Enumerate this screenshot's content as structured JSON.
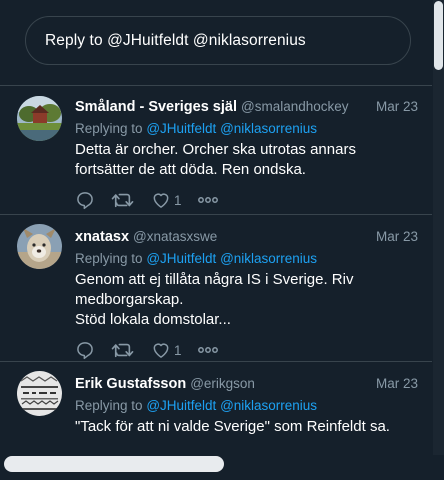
{
  "reply_box": {
    "text": "Reply to @JHuitfeldt @niklasorrenius"
  },
  "replying_label": "Replying to",
  "tweets": [
    {
      "name": "Småland - Sveriges själ",
      "handle": "@smalandhockey",
      "date": "Mar 23",
      "mentions": [
        "@JHuitfeldt",
        "@niklasorrenius"
      ],
      "lines": [
        "Detta är orcher. Orcher ska utrotas annars",
        "fortsätter de att döda. Ren ondska."
      ],
      "likes": "1"
    },
    {
      "name": "xnatasx",
      "handle": "@xnatasxswe",
      "date": "Mar 23",
      "mentions": [
        "@JHuitfeldt",
        "@niklasorrenius"
      ],
      "lines": [
        "Genom att ej tillåta några IS i Sverige. Riv",
        "medborgarskap.",
        "Stöd lokala domstolar..."
      ],
      "likes": "1"
    },
    {
      "name": "Erik Gustafsson",
      "handle": "@erikgson",
      "date": "Mar 23",
      "mentions": [
        "@JHuitfeldt",
        "@niklasorrenius"
      ],
      "lines": [
        "\"Tack för att ni valde Sverige\" som Reinfeldt sa."
      ],
      "likes": ""
    }
  ],
  "colors": {
    "background": "#15202b",
    "border": "#38444d",
    "muted": "#8899a6",
    "link": "#1da1f2",
    "text": "#ffffff"
  },
  "icons": [
    "reply-icon",
    "retweet-icon",
    "like-icon",
    "more-icon"
  ]
}
